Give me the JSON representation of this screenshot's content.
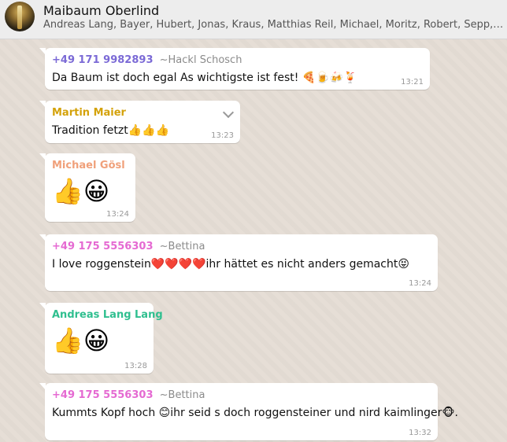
{
  "header": {
    "title": "Maibaum Oberlind",
    "members": "Andreas Lang, Bayer, Hubert, Jonas, Kraus, Matthias Reil, Michael, Moritz, Robert, Sepp, Stefan, ..."
  },
  "messages": [
    {
      "sender_number": "+49 171 9982893",
      "sender_alias": "~Hackl Schosch",
      "text": "Da Baum ist doch egal As wichtigste ist fest! 🍕🍺🍻🍹",
      "time": "13:21",
      "color": "#7b6ad6"
    },
    {
      "sender_name": "Martin Maier",
      "text": "Tradition fetzt👍👍👍",
      "time": "13:23",
      "color": "#d4a20a"
    },
    {
      "sender_name": "Michael Gösl",
      "text": "👍😀",
      "time": "13:24",
      "color": "#f0a07a"
    },
    {
      "sender_number": "+49 175 5556303",
      "sender_alias": "~Bettina",
      "text": "I love  roggenstein❤️❤️❤️❤️ihr hättet es nicht anders gemacht😝",
      "time": "13:24",
      "color": "#e56ad2"
    },
    {
      "sender_name": "Andreas Lang Lang",
      "text": "👍😀",
      "time": "13:28",
      "color": "#2fbf8f"
    },
    {
      "sender_number": "+49 175 5556303",
      "sender_alias": "~Bettina",
      "text": "Kummts Kopf  hoch 😊ihr seid s doch roggensteiner  und nird kaimlinger🐵.",
      "time": "13:32",
      "color": "#e56ad2"
    }
  ]
}
